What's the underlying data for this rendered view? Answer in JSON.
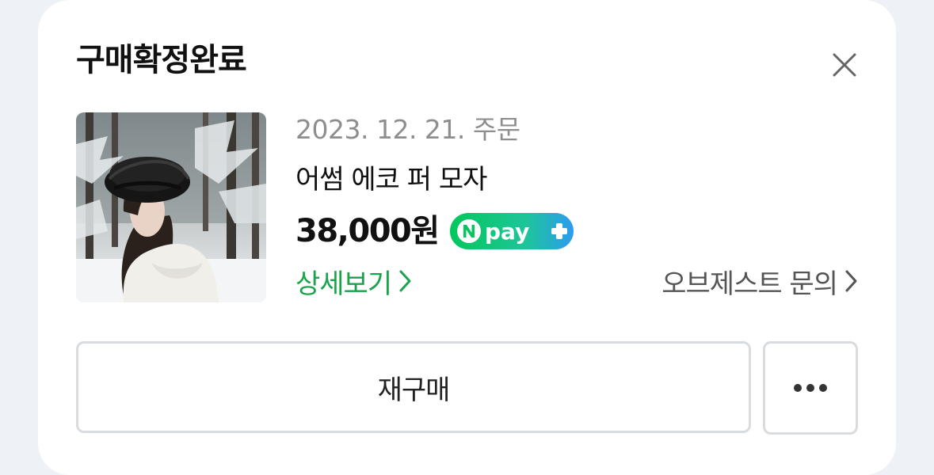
{
  "order": {
    "status_title": "구매확정완료",
    "date_label": "2023. 12. 21. 주문",
    "product_name": "어썸 에코 퍼 모자",
    "price": "38,000원",
    "npay_badge_text": "pay",
    "detail_link": "상세보기",
    "inquiry_link": "오브제스트 문의"
  },
  "actions": {
    "rebuy_label": "재구매",
    "more_icon": "more-horizontal-icon"
  },
  "icons": {
    "close": "close-icon",
    "chevron": "chevron-right-icon"
  },
  "colors": {
    "accent_green": "#1aa34a",
    "npay_green": "#03c75a",
    "npay_blue": "#2d9bf0",
    "price_text": "#111111",
    "muted_text": "#8e8e8e"
  }
}
